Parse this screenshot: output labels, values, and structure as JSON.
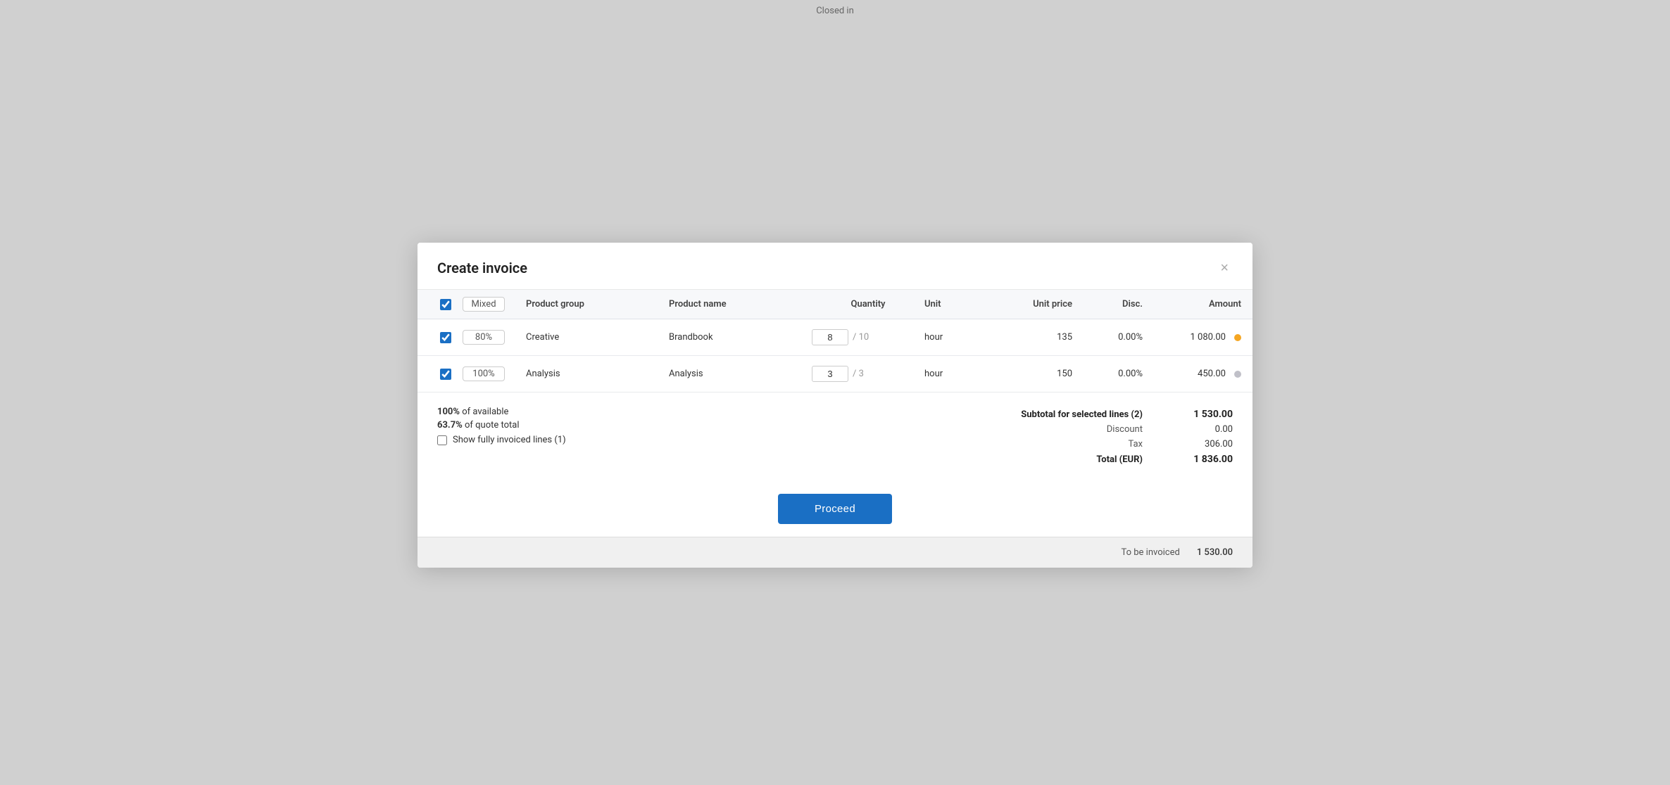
{
  "topBar": {
    "text": "Closed in"
  },
  "modal": {
    "title": "Create invoice",
    "close_label": "×"
  },
  "table": {
    "header": {
      "col1": "",
      "col2": "",
      "product_group": "Product group",
      "product_name": "Product name",
      "quantity": "Quantity",
      "unit": "Unit",
      "unit_price": "Unit price",
      "disc": "Disc.",
      "amount": "Amount"
    },
    "header_row": {
      "badge": "Mixed"
    },
    "rows": [
      {
        "id": "row1",
        "checked": true,
        "badge": "80%",
        "product_group": "Creative",
        "product_name": "Brandbook",
        "qty_value": "8",
        "qty_total": "/ 10",
        "unit": "hour",
        "unit_price": "135",
        "disc": "0.00%",
        "amount": "1 080.00",
        "dot": "orange"
      },
      {
        "id": "row2",
        "checked": true,
        "badge": "100%",
        "product_group": "Analysis",
        "product_name": "Analysis",
        "qty_value": "3",
        "qty_total": "/ 3",
        "unit": "hour",
        "unit_price": "150",
        "disc": "0.00%",
        "amount": "450.00",
        "dot": "gray"
      }
    ]
  },
  "summary": {
    "stat1_bold": "100%",
    "stat1_text": " of available",
    "stat2_bold": "63.7%",
    "stat2_text": " of quote total",
    "show_invoiced_label": "Show fully invoiced lines (1)",
    "subtotal_label": "Subtotal for selected lines (2)",
    "subtotal_value": "1 530.00",
    "discount_label": "Discount",
    "discount_value": "0.00",
    "tax_label": "Tax",
    "tax_value": "306.00",
    "total_label": "Total (EUR)",
    "total_value": "1 836.00"
  },
  "proceed": {
    "button_label": "Proceed"
  },
  "footer": {
    "label": "To be invoiced",
    "value": "1 530.00"
  }
}
